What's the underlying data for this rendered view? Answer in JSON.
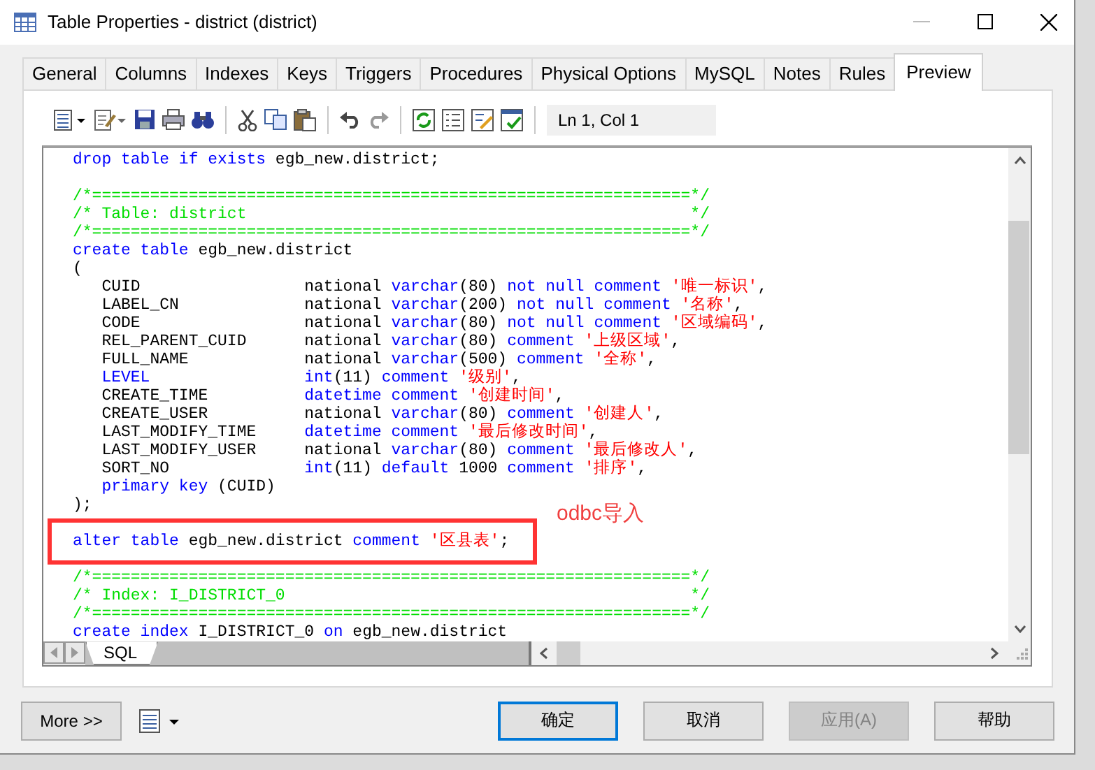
{
  "window": {
    "title": "Table Properties - district (district)"
  },
  "tabs": [
    {
      "label": "General",
      "selected": false
    },
    {
      "label": "Columns",
      "selected": false
    },
    {
      "label": "Indexes",
      "selected": false
    },
    {
      "label": "Keys",
      "selected": false
    },
    {
      "label": "Triggers",
      "selected": false
    },
    {
      "label": "Procedures",
      "selected": false
    },
    {
      "label": "Physical Options",
      "selected": false
    },
    {
      "label": "MySQL",
      "selected": false
    },
    {
      "label": "Notes",
      "selected": false
    },
    {
      "label": "Rules",
      "selected": false
    },
    {
      "label": "Preview",
      "selected": true
    }
  ],
  "toolbar": {
    "position": "Ln 1, Col 1"
  },
  "code_lines": [
    {
      "kind": "code",
      "boxed": false,
      "tokens": [
        {
          "kind": "kw",
          "text": "drop table if exists"
        },
        {
          "kind": "id",
          "text": " egb_new.district;"
        }
      ]
    },
    {
      "kind": "blank"
    },
    {
      "kind": "code",
      "boxed": false,
      "tokens": [
        {
          "kind": "cm",
          "text": "/*==============================================================*/"
        }
      ]
    },
    {
      "kind": "code",
      "boxed": false,
      "tokens": [
        {
          "kind": "cm",
          "text": "/* Table: district                                              */"
        }
      ]
    },
    {
      "kind": "code",
      "boxed": false,
      "tokens": [
        {
          "kind": "cm",
          "text": "/*==============================================================*/"
        }
      ]
    },
    {
      "kind": "code",
      "boxed": false,
      "tokens": [
        {
          "kind": "kw",
          "text": "create table"
        },
        {
          "kind": "id",
          "text": " egb_new.district"
        }
      ]
    },
    {
      "kind": "code",
      "boxed": false,
      "tokens": [
        {
          "kind": "id",
          "text": "("
        }
      ]
    },
    {
      "kind": "code",
      "boxed": false,
      "tokens": [
        {
          "kind": "id",
          "text": "   CUID                 national "
        },
        {
          "kind": "kw",
          "text": "varchar"
        },
        {
          "kind": "id",
          "text": "(80) "
        },
        {
          "kind": "kw",
          "text": "not null comment "
        },
        {
          "kind": "str",
          "text": "'唯一标识'"
        },
        {
          "kind": "id",
          "text": ","
        }
      ]
    },
    {
      "kind": "code",
      "boxed": false,
      "tokens": [
        {
          "kind": "id",
          "text": "   LABEL_CN             national "
        },
        {
          "kind": "kw",
          "text": "varchar"
        },
        {
          "kind": "id",
          "text": "(200) "
        },
        {
          "kind": "kw",
          "text": "not null comment "
        },
        {
          "kind": "str",
          "text": "'名称'"
        },
        {
          "kind": "id",
          "text": ","
        }
      ]
    },
    {
      "kind": "code",
      "boxed": false,
      "tokens": [
        {
          "kind": "id",
          "text": "   CODE                 national "
        },
        {
          "kind": "kw",
          "text": "varchar"
        },
        {
          "kind": "id",
          "text": "(80) "
        },
        {
          "kind": "kw",
          "text": "not null comment "
        },
        {
          "kind": "str",
          "text": "'区域编码'"
        },
        {
          "kind": "id",
          "text": ","
        }
      ]
    },
    {
      "kind": "code",
      "boxed": false,
      "tokens": [
        {
          "kind": "id",
          "text": "   REL_PARENT_CUID      national "
        },
        {
          "kind": "kw",
          "text": "varchar"
        },
        {
          "kind": "id",
          "text": "(80) "
        },
        {
          "kind": "kw",
          "text": "comment "
        },
        {
          "kind": "str",
          "text": "'上级区域'"
        },
        {
          "kind": "id",
          "text": ","
        }
      ]
    },
    {
      "kind": "code",
      "boxed": false,
      "tokens": [
        {
          "kind": "id",
          "text": "   FULL_NAME            national "
        },
        {
          "kind": "kw",
          "text": "varchar"
        },
        {
          "kind": "id",
          "text": "(500) "
        },
        {
          "kind": "kw",
          "text": "comment "
        },
        {
          "kind": "str",
          "text": "'全称'"
        },
        {
          "kind": "id",
          "text": ","
        }
      ]
    },
    {
      "kind": "code",
      "boxed": false,
      "tokens": [
        {
          "kind": "kw",
          "text": "   LEVEL                int"
        },
        {
          "kind": "id",
          "text": "(11) "
        },
        {
          "kind": "kw",
          "text": "comment "
        },
        {
          "kind": "str",
          "text": "'级别'"
        },
        {
          "kind": "id",
          "text": ","
        }
      ]
    },
    {
      "kind": "code",
      "boxed": false,
      "tokens": [
        {
          "kind": "id",
          "text": "   CREATE_TIME          "
        },
        {
          "kind": "kw",
          "text": "datetime comment "
        },
        {
          "kind": "str",
          "text": "'创建时间'"
        },
        {
          "kind": "id",
          "text": ","
        }
      ]
    },
    {
      "kind": "code",
      "boxed": false,
      "tokens": [
        {
          "kind": "id",
          "text": "   CREATE_USER          national "
        },
        {
          "kind": "kw",
          "text": "varchar"
        },
        {
          "kind": "id",
          "text": "(80) "
        },
        {
          "kind": "kw",
          "text": "comment "
        },
        {
          "kind": "str",
          "text": "'创建人'"
        },
        {
          "kind": "id",
          "text": ","
        }
      ]
    },
    {
      "kind": "code",
      "boxed": false,
      "tokens": [
        {
          "kind": "id",
          "text": "   LAST_MODIFY_TIME     "
        },
        {
          "kind": "kw",
          "text": "datetime comment "
        },
        {
          "kind": "str",
          "text": "'最后修改时间'"
        },
        {
          "kind": "id",
          "text": ","
        }
      ]
    },
    {
      "kind": "code",
      "boxed": false,
      "tokens": [
        {
          "kind": "id",
          "text": "   LAST_MODIFY_USER     national "
        },
        {
          "kind": "kw",
          "text": "varchar"
        },
        {
          "kind": "id",
          "text": "(80) "
        },
        {
          "kind": "kw",
          "text": "comment "
        },
        {
          "kind": "str",
          "text": "'最后修改人'"
        },
        {
          "kind": "id",
          "text": ","
        }
      ]
    },
    {
      "kind": "code",
      "boxed": false,
      "tokens": [
        {
          "kind": "id",
          "text": "   SORT_NO              "
        },
        {
          "kind": "kw",
          "text": "int"
        },
        {
          "kind": "id",
          "text": "(11) "
        },
        {
          "kind": "kw",
          "text": "default "
        },
        {
          "kind": "id",
          "text": "1000 "
        },
        {
          "kind": "kw",
          "text": "comment "
        },
        {
          "kind": "str",
          "text": "'排序'"
        },
        {
          "kind": "id",
          "text": ","
        }
      ]
    },
    {
      "kind": "code",
      "boxed": false,
      "tokens": [
        {
          "kind": "kw",
          "text": "   primary key"
        },
        {
          "kind": "id",
          "text": " (CUID)"
        }
      ]
    },
    {
      "kind": "code",
      "boxed": false,
      "tokens": [
        {
          "kind": "id",
          "text": ");"
        }
      ]
    },
    {
      "kind": "code",
      "boxed": true,
      "tokens": [
        {
          "kind": "kw",
          "text": "alter table"
        },
        {
          "kind": "id",
          "text": " egb_new.district "
        },
        {
          "kind": "kw",
          "text": "comment "
        },
        {
          "kind": "str",
          "text": "'区县表'"
        },
        {
          "kind": "id",
          "text": ";"
        }
      ]
    },
    {
      "kind": "code",
      "boxed": false,
      "tokens": [
        {
          "kind": "cm",
          "text": "/*==============================================================*/"
        }
      ]
    },
    {
      "kind": "code",
      "boxed": false,
      "tokens": [
        {
          "kind": "cm",
          "text": "/* Index: I_DISTRICT_0                                          */"
        }
      ]
    },
    {
      "kind": "code",
      "boxed": false,
      "tokens": [
        {
          "kind": "cm",
          "text": "/*==============================================================*/"
        }
      ]
    },
    {
      "kind": "code",
      "boxed": false,
      "tokens": [
        {
          "kind": "kw",
          "text": "create index"
        },
        {
          "kind": "id",
          "text": " I_DISTRICT_0 "
        },
        {
          "kind": "kw",
          "text": "on"
        },
        {
          "kind": "id",
          "text": " egb_new.district"
        }
      ]
    }
  ],
  "annotation": "odbc导入",
  "editor_tab": "SQL",
  "more_button": "More >>",
  "buttons": [
    {
      "label": "确定",
      "default": true,
      "disabled": false
    },
    {
      "label": "取消",
      "default": false,
      "disabled": false
    },
    {
      "label": "应用(A)",
      "default": false,
      "disabled": true
    },
    {
      "label": "帮助",
      "default": false,
      "disabled": false
    }
  ]
}
